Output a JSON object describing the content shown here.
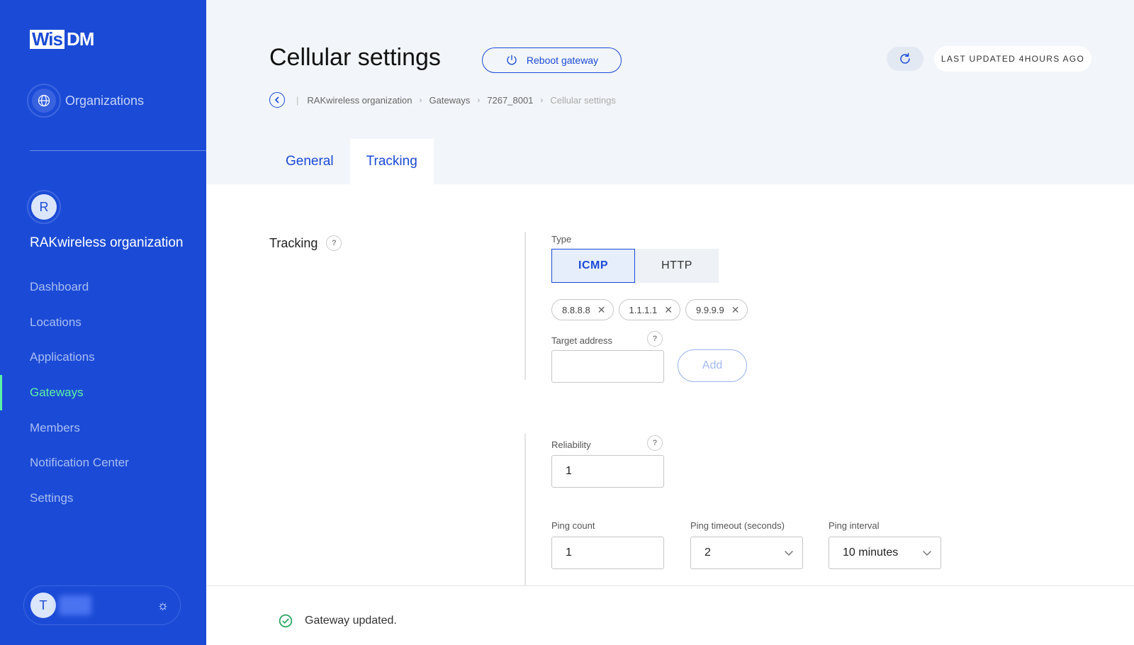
{
  "brand": {
    "logo_part1": "Wis",
    "logo_part2": "DM"
  },
  "sidebar": {
    "organizations_label": "Organizations",
    "org_initial": "R",
    "org_name": "RAKwireless organization",
    "items": [
      {
        "label": "Dashboard",
        "active": false
      },
      {
        "label": "Locations",
        "active": false
      },
      {
        "label": "Applications",
        "active": false
      },
      {
        "label": "Gateways",
        "active": true
      },
      {
        "label": "Members",
        "active": false
      },
      {
        "label": "Notification Center",
        "active": false
      },
      {
        "label": "Settings",
        "active": false
      }
    ],
    "user_initial": "T"
  },
  "header": {
    "title": "Cellular settings",
    "reboot_label": "Reboot gateway",
    "last_updated": "LAST UPDATED 4HOURS AGO"
  },
  "breadcrumb": {
    "items": [
      "RAKwireless organization",
      "Gateways",
      "7267_8001"
    ],
    "current": "Cellular settings"
  },
  "tabs": [
    {
      "label": "General",
      "active": false
    },
    {
      "label": "Tracking",
      "active": true
    }
  ],
  "tracking": {
    "section_label": "Tracking",
    "type_label": "Type",
    "type_options": [
      "ICMP",
      "HTTP"
    ],
    "type_selected": "ICMP",
    "targets": [
      "8.8.8.8",
      "1.1.1.1",
      "9.9.9.9"
    ],
    "target_address_label": "Target address",
    "target_address_value": "",
    "add_label": "Add",
    "reliability_label": "Reliability",
    "reliability_value": "1",
    "ping_count_label": "Ping count",
    "ping_count_value": "1",
    "ping_timeout_label": "Ping timeout (seconds)",
    "ping_timeout_value": "2",
    "ping_interval_label": "Ping interval",
    "ping_interval_value": "10 minutes"
  },
  "toast": {
    "message": "Gateway updated."
  },
  "colors": {
    "sidebar": "#1b4bd6",
    "accent": "#1b4bd6",
    "active_nav": "#5bf2a5",
    "success": "#1fa25a"
  }
}
